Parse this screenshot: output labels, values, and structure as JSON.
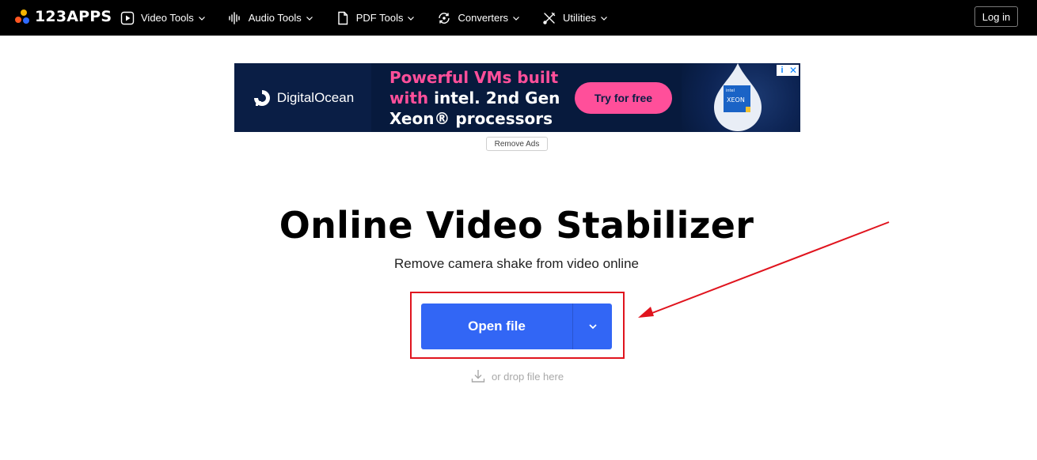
{
  "header": {
    "logo_text": "123APPS",
    "nav": [
      {
        "label": "Video Tools",
        "icon": "play-icon"
      },
      {
        "label": "Audio Tools",
        "icon": "waveform-icon"
      },
      {
        "label": "PDF Tools",
        "icon": "document-icon"
      },
      {
        "label": "Converters",
        "icon": "refresh-icon"
      },
      {
        "label": "Utilities",
        "icon": "tools-icon"
      }
    ],
    "login_label": "Log in"
  },
  "ad": {
    "brand": "DigitalOcean",
    "line1": "Powerful VMs built",
    "line2_a": "with",
    "line2_b": "intel.",
    "line2_c": "2nd Gen",
    "line3": "Xeon® processors",
    "cta": "Try for free",
    "badge_top": "intel",
    "badge_mid": "XEON",
    "info_icon": "i",
    "close_icon": "✕",
    "colors": {
      "background": "#071a3d",
      "accent": "#ff4f9a"
    }
  },
  "remove_ads_label": "Remove Ads",
  "main": {
    "title": "Online Video Stabilizer",
    "subtitle": "Remove camera shake from video online",
    "open_file_label": "Open file",
    "drop_hint": "or drop file here"
  },
  "annotation": {
    "color": "#e0141e"
  },
  "colors": {
    "primary_button": "#3266f5",
    "navbar": "#000000"
  }
}
